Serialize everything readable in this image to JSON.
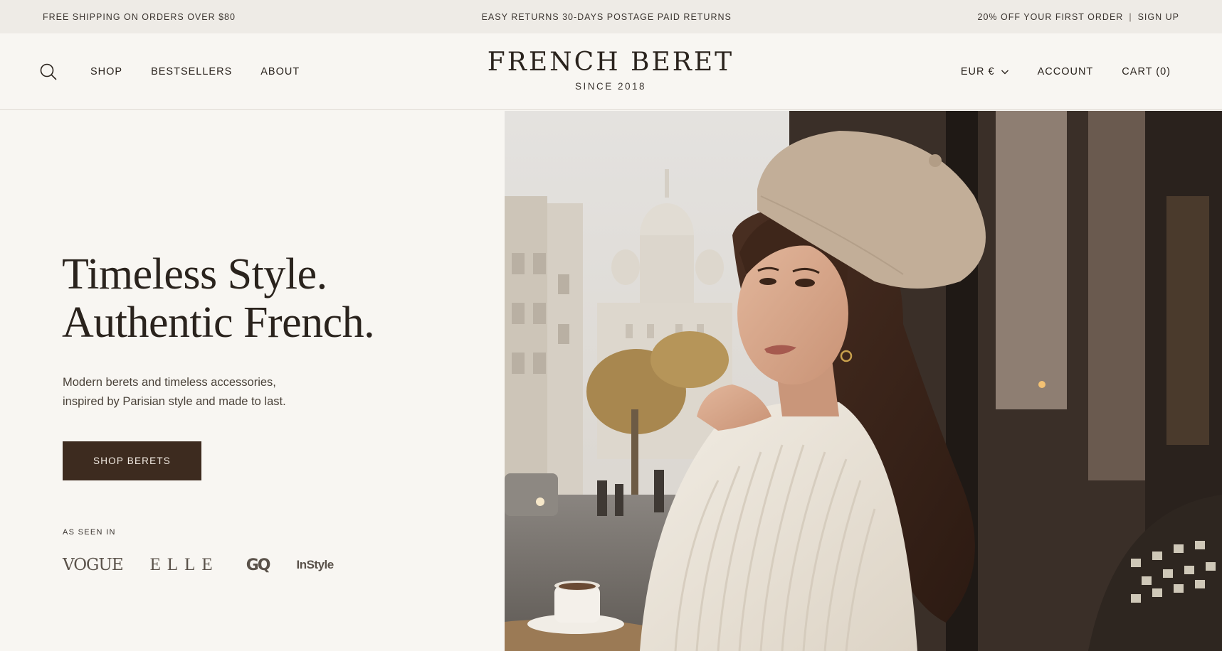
{
  "announcement": {
    "left": "FREE SHIPPING ON ORDERS OVER $80",
    "center": "EASY RETURNS 30-DAYS POSTAGE PAID RETURNS",
    "right_offer": "20% OFF YOUR FIRST ORDER",
    "separator": "|",
    "right_link": "SIGN UP"
  },
  "header": {
    "nav": [
      "SHOP",
      "BESTSELLERS",
      "ABOUT"
    ],
    "brand": "FRENCH BERET",
    "since": "SINCE 2018",
    "currency": "EUR €",
    "account": "ACCOUNT",
    "cart": "CART (0)"
  },
  "hero": {
    "headline_line1": "Timeless Style.",
    "headline_line2": "Authentic French.",
    "subcopy_line1": "Modern berets and timeless accessories,",
    "subcopy_line2": "inspired by Parisian style and made to last.",
    "cta": "SHOP BERETS",
    "as_seen_in": "AS SEEN IN",
    "press": [
      "VOGUE",
      "ELLE",
      "GQ",
      "InStyle"
    ]
  },
  "colors": {
    "background": "#f8f6f2",
    "topbar": "#eeebe6",
    "cta": "#3d2b1f",
    "text": "#2a231d"
  },
  "icons": {
    "search": "search-icon",
    "currency_dropdown": "chevron-down-icon"
  }
}
